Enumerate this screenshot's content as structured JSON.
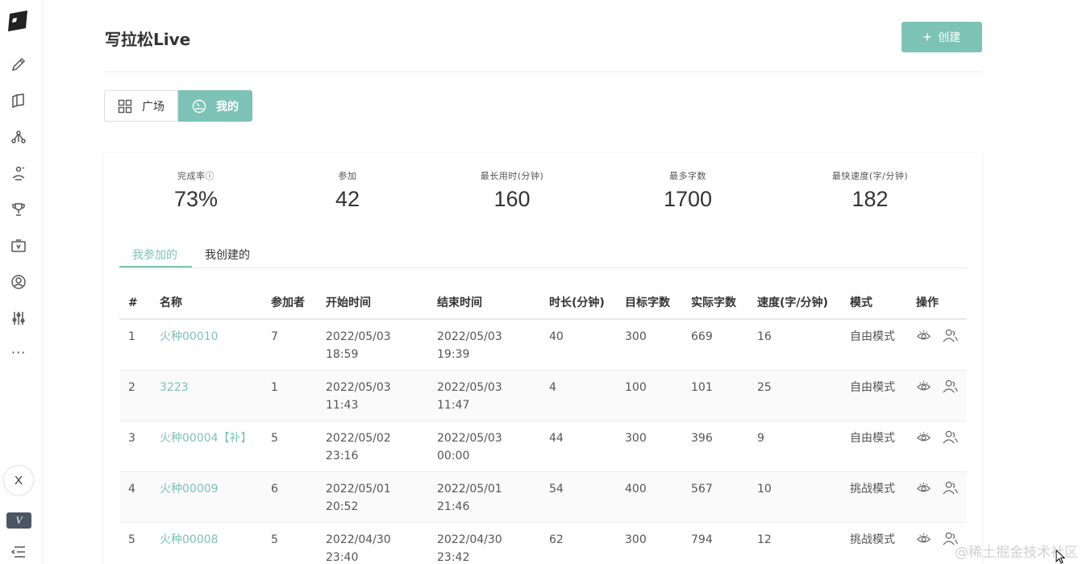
{
  "header": {
    "title": "写拉松Live",
    "create_label": "创建"
  },
  "segmented": {
    "square": "广场",
    "mine": "我的"
  },
  "stats": [
    {
      "label": "完成率ⓘ",
      "value": "73%"
    },
    {
      "label": "参加",
      "value": "42"
    },
    {
      "label": "最长用时(分钟)",
      "value": "160"
    },
    {
      "label": "最多字数",
      "value": "1700"
    },
    {
      "label": "最快速度(字/分钟)",
      "value": "182"
    }
  ],
  "tabs": {
    "joined": "我参加的",
    "created": "我创建的"
  },
  "table": {
    "headers": [
      "#",
      "名称",
      "参加者",
      "开始时间",
      "结束时间",
      "时长(分钟)",
      "目标字数",
      "实际字数",
      "速度(字/分钟)",
      "模式",
      "操作"
    ],
    "rows": [
      {
        "no": "1",
        "name": "火种00010",
        "participants": "7",
        "start_date": "2022/05/03",
        "start_time": "18:59",
        "end_date": "2022/05/03",
        "end_time": "19:39",
        "duration": "40",
        "target": "300",
        "actual": "669",
        "speed": "16",
        "mode": "自由模式"
      },
      {
        "no": "2",
        "name": "3223",
        "participants": "1",
        "start_date": "2022/05/03",
        "start_time": "11:43",
        "end_date": "2022/05/03",
        "end_time": "11:47",
        "duration": "4",
        "target": "100",
        "actual": "101",
        "speed": "25",
        "mode": "自由模式"
      },
      {
        "no": "3",
        "name": "火种00004【补】",
        "participants": "5",
        "start_date": "2022/05/02",
        "start_time": "23:16",
        "end_date": "2022/05/03",
        "end_time": "00:00",
        "duration": "44",
        "target": "300",
        "actual": "396",
        "speed": "9",
        "mode": "自由模式"
      },
      {
        "no": "4",
        "name": "火种00009",
        "participants": "6",
        "start_date": "2022/05/01",
        "start_time": "20:52",
        "end_date": "2022/05/01",
        "end_time": "21:46",
        "duration": "54",
        "target": "400",
        "actual": "567",
        "speed": "10",
        "mode": "挑战模式"
      },
      {
        "no": "5",
        "name": "火种00008",
        "participants": "5",
        "start_date": "2022/04/30",
        "start_time": "23:40",
        "end_date": "2022/04/30",
        "end_time": "23:42",
        "duration": "62",
        "target": "300",
        "actual": "794",
        "speed": "12",
        "mode": "挑战模式"
      }
    ]
  },
  "sidebar": {
    "x_label": "X",
    "v_label": "V",
    "more_label": "···"
  },
  "watermark": "@稀土掘金技术社区",
  "colors": {
    "accent": "#7cc3b5",
    "link": "#7cc3b5",
    "text": "#333333"
  }
}
